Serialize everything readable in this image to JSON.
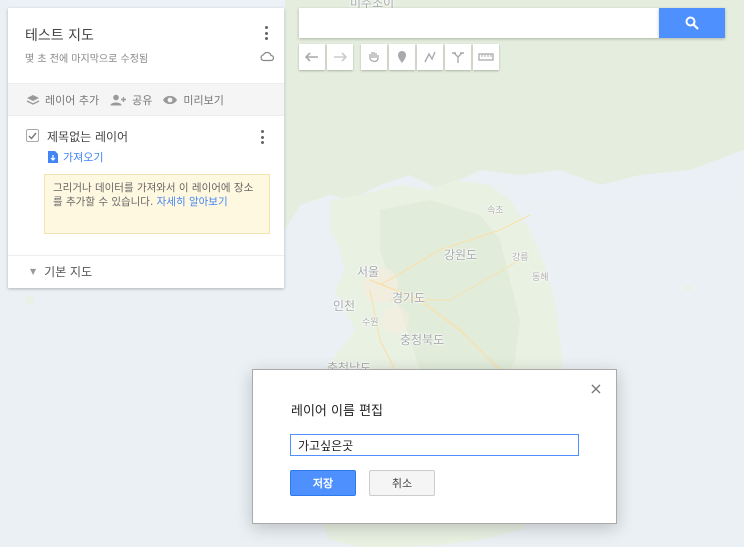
{
  "map": {
    "labels": {
      "top": "미주조이",
      "gangwon": "강원도",
      "seoul": "서울",
      "gyeonggi": "경기도",
      "incheon": "인천",
      "suwon": "수원",
      "chungbuk": "충청북도",
      "gangneung": "강릉",
      "sokcho": "속초",
      "donghae": "동해",
      "chungnam": "충청남도"
    }
  },
  "panel": {
    "title": "테스트 지도",
    "subtitle": "몇 초 전에 마지막으로 수정됨",
    "actions": {
      "add_layer": "레이어 추가",
      "share": "공유",
      "preview": "미리보기"
    },
    "layer": {
      "name": "제목없는 레이어",
      "import": "가져오기",
      "hint": "그리거나 데이터를 가져와서 이 레이어에 장소를 추가할 수 있습니다.",
      "hint_link": "자세히 알아보기"
    },
    "base_map": "기본 지도"
  },
  "search": {
    "value": ""
  },
  "dialog": {
    "title": "레이어 이름 편집",
    "input_value": "가고싶은곳",
    "save_label": "저장",
    "cancel_label": "취소",
    "close_glyph": "×"
  },
  "colors": {
    "accent": "#4d90fe",
    "link": "#4285f4",
    "hint_bg": "#fff8e1"
  }
}
